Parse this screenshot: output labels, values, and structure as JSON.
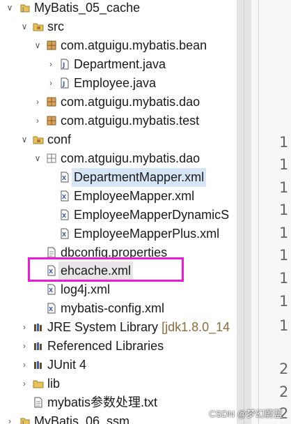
{
  "project_explorer": {
    "project": "MyBatis_05_cache",
    "src": "src",
    "bean_package": "com.atguigu.mybatis.bean",
    "department_java": "Department.java",
    "employee_java": "Employee.java",
    "dao_package": "com.atguigu.mybatis.dao",
    "test_package": "com.atguigu.mybatis.test",
    "conf": "conf",
    "conf_dao_package": "com.atguigu.mybatis.dao",
    "department_mapper": "DepartmentMapper.xml",
    "employee_mapper": "EmployeeMapper.xml",
    "employee_mapper_dynamic": "EmployeeMapperDynamicS",
    "employee_mapper_plus": "EmployeeMapperPlus.xml",
    "dbconfig": "dbconfig.properties",
    "ehcache": "ehcache.xml",
    "log4j": "log4j.xml",
    "mybatis_config": "mybatis-config.xml",
    "jre_library": "JRE System Library",
    "jre_version": "[jdk1.8.0_14",
    "referenced_libraries": "Referenced Libraries",
    "junit": "JUnit 4",
    "lib": "lib",
    "notes_txt": "mybatis参数处理.txt",
    "next_project": "MyBatis_06_ssm"
  },
  "editor": {
    "line_numbers": [
      "1",
      "1",
      "1",
      "1",
      "1",
      "1",
      "1",
      "1",
      "1",
      "2",
      "2",
      "2"
    ]
  },
  "watermark": "CSDN @梦幻蔚蓝",
  "colors": {
    "highlight_border": "#ee1ad6",
    "selection": "#d6e6f7",
    "package_icon": "#b5763a",
    "folder_icon": "#e8c15a",
    "xml_icon": "#3a5fa8",
    "java_icon": "#3a5fa8"
  }
}
